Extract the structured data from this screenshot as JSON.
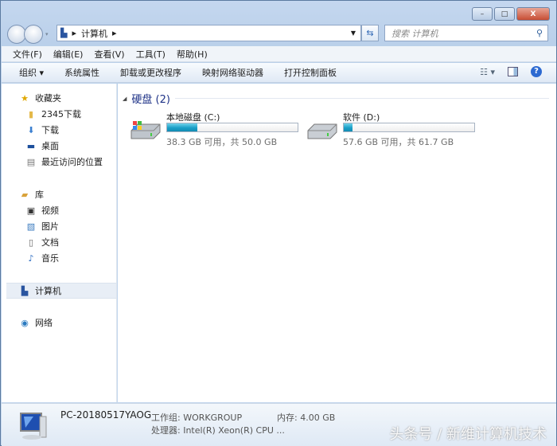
{
  "window": {
    "minimize": "–",
    "maximize": "□",
    "close": "X"
  },
  "address": {
    "root": "计算机",
    "sep": "▸"
  },
  "search": {
    "placeholder": "搜索 计算机"
  },
  "menu": [
    "文件(F)",
    "编辑(E)",
    "查看(V)",
    "工具(T)",
    "帮助(H)"
  ],
  "commands": [
    "组织 ▾",
    "系统属性",
    "卸载或更改程序",
    "映射网络驱动器",
    "打开控制面板"
  ],
  "sidebar": {
    "favorites": {
      "label": "收藏夹",
      "items": [
        "2345下载",
        "下载",
        "桌面",
        "最近访问的位置"
      ]
    },
    "libraries": {
      "label": "库",
      "items": [
        "视频",
        "图片",
        "文档",
        "音乐"
      ]
    },
    "computer": "计算机",
    "network": "网络"
  },
  "main": {
    "group": "硬盘 (2)",
    "drives": [
      {
        "name": "本地磁盘 (C:)",
        "info": "38.3 GB 可用，共 50.0 GB",
        "used_percent": 23.4
      },
      {
        "name": "软件 (D:)",
        "info": "57.6 GB 可用，共 61.7 GB",
        "used_percent": 6.6
      }
    ]
  },
  "status": {
    "pc": "PC-20180517YAOG",
    "workgroup": "工作组: WORKGROUP",
    "memory": "内存: 4.00 GB",
    "cpu": "处理器: Intel(R) Xeon(R) CPU ..."
  },
  "watermark": "头条号 / 新维计算机技术"
}
